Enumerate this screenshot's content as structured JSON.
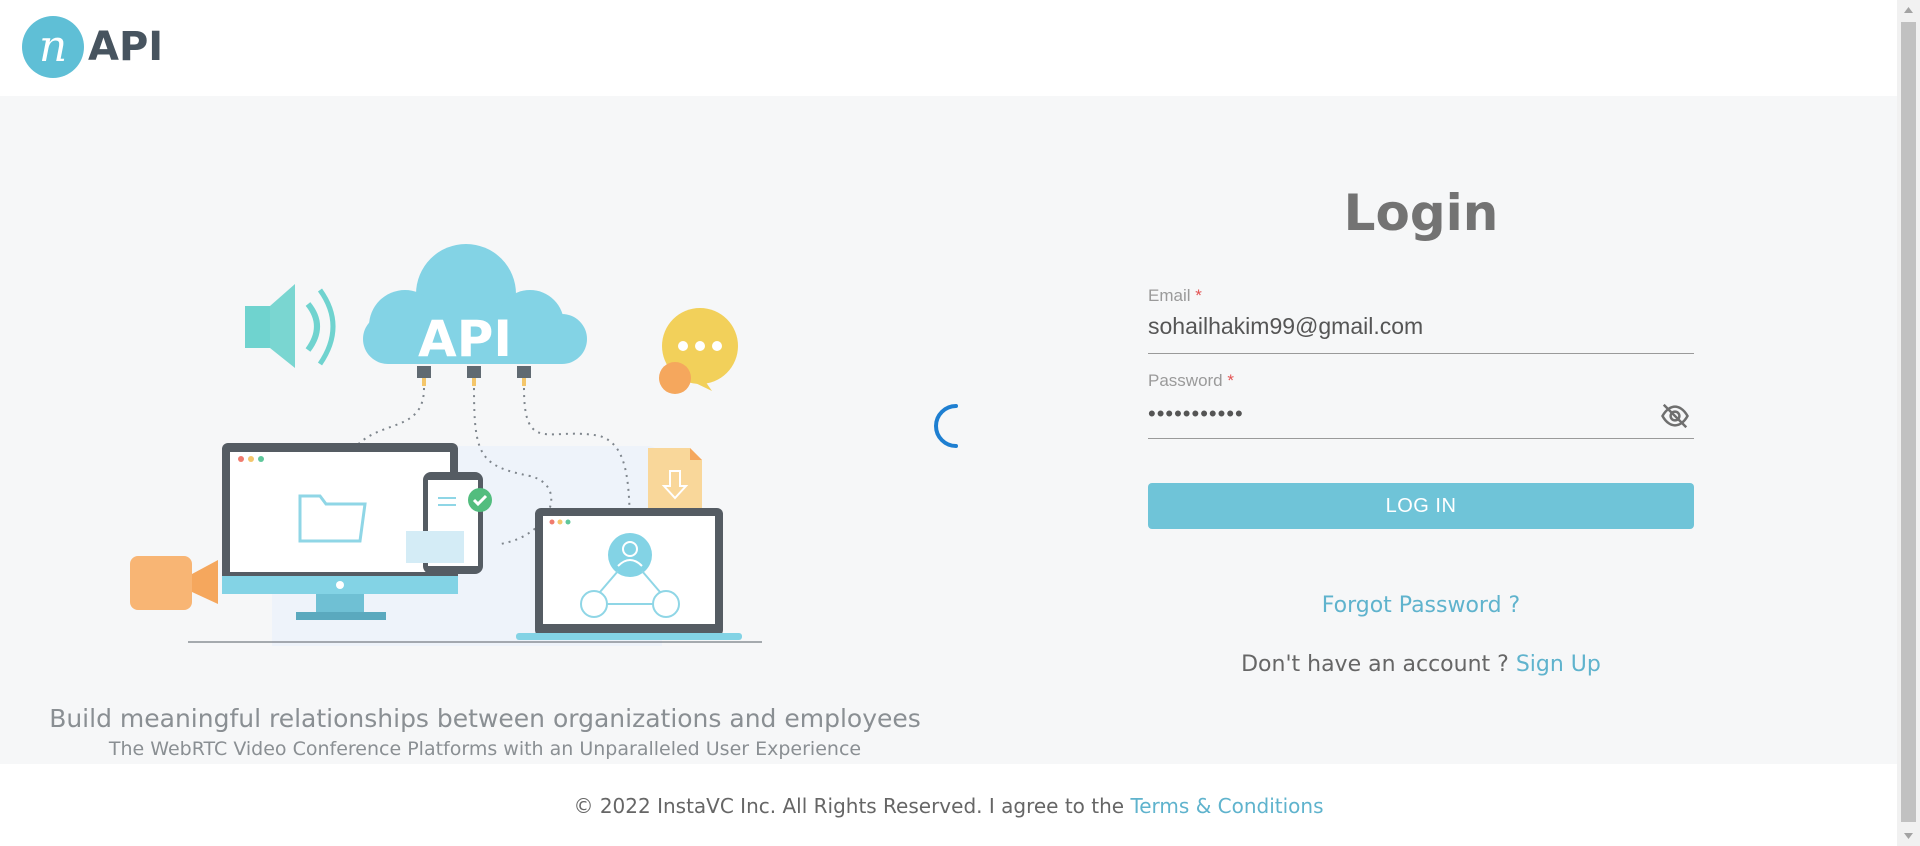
{
  "header": {
    "logo_letter": "n",
    "logo_text": "API"
  },
  "illustration": {
    "cloud_text": "API"
  },
  "tagline": {
    "headline": "Build meaningful relationships between organizations and employees",
    "subline": "The WebRTC Video Conference Platforms with an Unparalleled User Experience"
  },
  "login": {
    "title": "Login",
    "email_label": "Email",
    "email_value": "sohailhakim99@gmail.com",
    "password_label": "Password",
    "password_value": "•••••••••••",
    "required_mark": "*",
    "login_button": "LOG IN",
    "forgot_password": "Forgot Password ?",
    "no_account_text": "Don't have an account ?",
    "signup_link": "Sign Up"
  },
  "footer": {
    "copyright": "© 2022 InstaVC Inc. All Rights Reserved. I agree to the",
    "terms_link": "Terms & Conditions"
  },
  "colors": {
    "accent": "#6fc4d8",
    "link": "#5fb3cd",
    "background": "#f6f7f8",
    "spinner": "#1e7fd1"
  },
  "icons": {
    "password_toggle": "eye-off-icon",
    "loading": "spinner-icon"
  }
}
